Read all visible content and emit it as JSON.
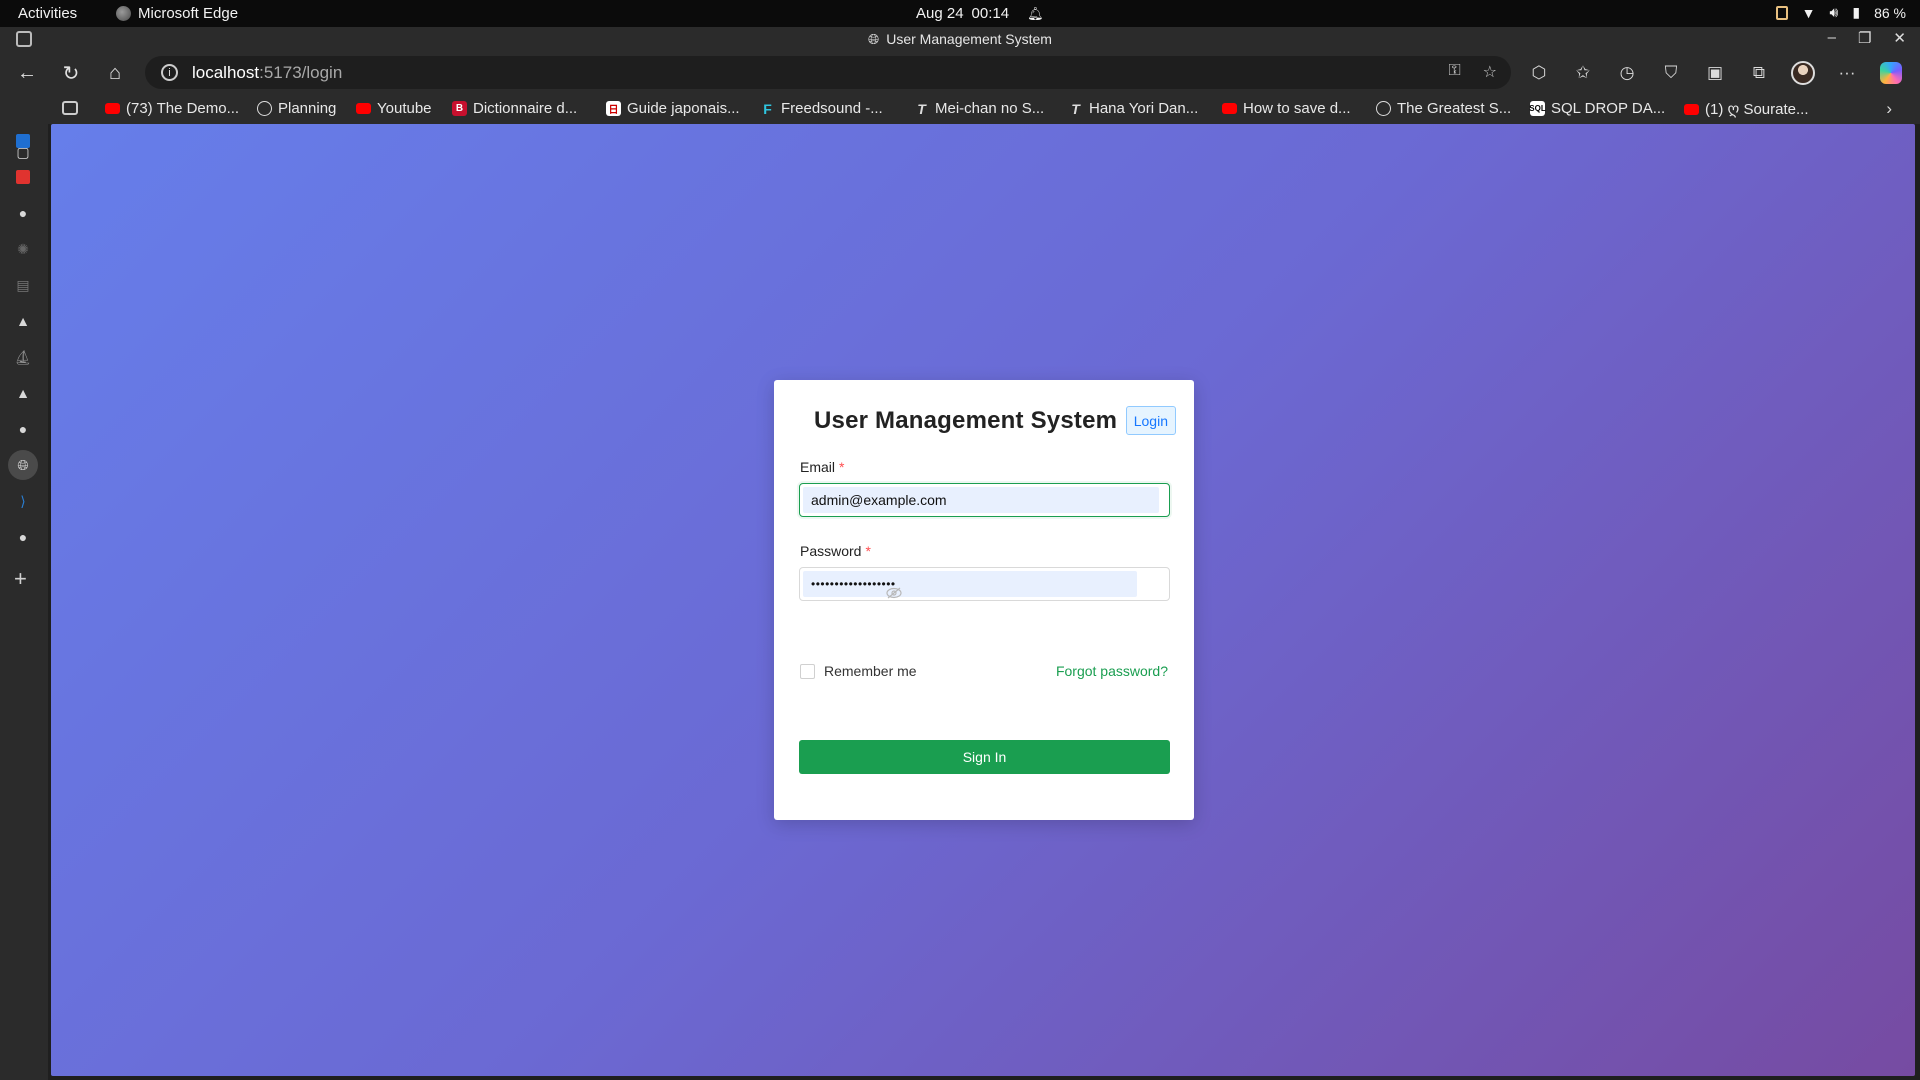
{
  "topbar": {
    "activities": "Activities",
    "app_name": "Microsoft Edge",
    "date": "Aug 24",
    "time": "00:14",
    "battery": "86 %"
  },
  "browser": {
    "window_title": "User Management System",
    "url_host": "localhost",
    "url_path": ":5173/login",
    "bookmarks": [
      {
        "icon": "youtube-icon",
        "label": "(73) The Demo..."
      },
      {
        "icon": "globe-icon",
        "label": "Planning"
      },
      {
        "icon": "youtube-icon",
        "label": "Youtube"
      },
      {
        "icon": "dictionary-icon",
        "label": "Dictionnaire d..."
      },
      {
        "icon": "japanese-guide-icon",
        "label": "Guide japonais..."
      },
      {
        "icon": "freedsound-icon",
        "label": "Freedsound -..."
      },
      {
        "icon": "translation-icon",
        "label": "Mei-chan no S..."
      },
      {
        "icon": "translation-icon",
        "label": "Hana Yori Dan..."
      },
      {
        "icon": "youtube-icon",
        "label": "How to save d..."
      },
      {
        "icon": "globe-icon",
        "label": "The Greatest S..."
      },
      {
        "icon": "sql-icon",
        "label": "SQL DROP DA..."
      },
      {
        "icon": "youtube-icon",
        "label": "(1) ღ Sourate..."
      }
    ]
  },
  "login": {
    "title": "User Management System",
    "tag": "Login",
    "email_label": "Email",
    "email_required": "*",
    "email_value": "admin@example.com",
    "password_label": "Password",
    "password_required": "*",
    "password_value": "••••••••••••••••••",
    "remember_label": "Remember me",
    "forgot_label": "Forgot password?",
    "submit_label": "Sign In"
  },
  "colors": {
    "primary_green": "#1a9e50",
    "tag_blue": "#1677ff",
    "bg_gradient_start": "#667eea",
    "bg_gradient_end": "#764ba2"
  }
}
